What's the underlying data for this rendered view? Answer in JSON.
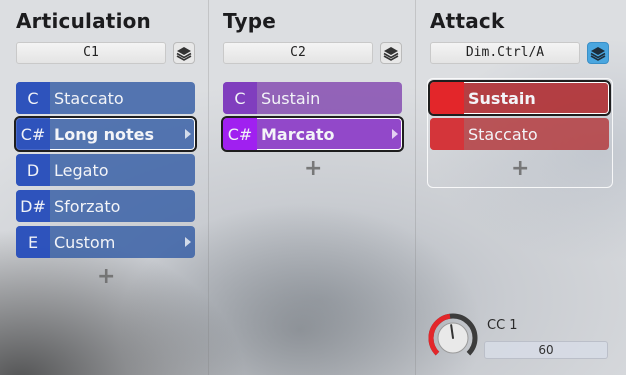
{
  "articulation": {
    "title": "Articulation",
    "field": "C1",
    "items": [
      {
        "key": "C",
        "label": "Staccato"
      },
      {
        "key": "C#",
        "label": "Long notes"
      },
      {
        "key": "D",
        "label": "Legato"
      },
      {
        "key": "D#",
        "label": "Sforzato"
      },
      {
        "key": "E",
        "label": "Custom"
      }
    ]
  },
  "type": {
    "title": "Type",
    "field": "C2",
    "items": [
      {
        "key": "C",
        "label": "Sustain"
      },
      {
        "key": "C#",
        "label": "Marcato"
      }
    ]
  },
  "attack": {
    "title": "Attack",
    "field": "Dim.Ctrl/A",
    "items": [
      {
        "key": "",
        "label": "Sustain"
      },
      {
        "key": "",
        "label": "Staccato"
      }
    ]
  },
  "cc": {
    "label": "CC 1",
    "value": "60",
    "level": 0.47
  },
  "add_symbol": "+",
  "colors": {
    "blue": "#355da5",
    "purple": "#8248b0",
    "red": "#e3262a",
    "accent": "#4aa6df"
  }
}
